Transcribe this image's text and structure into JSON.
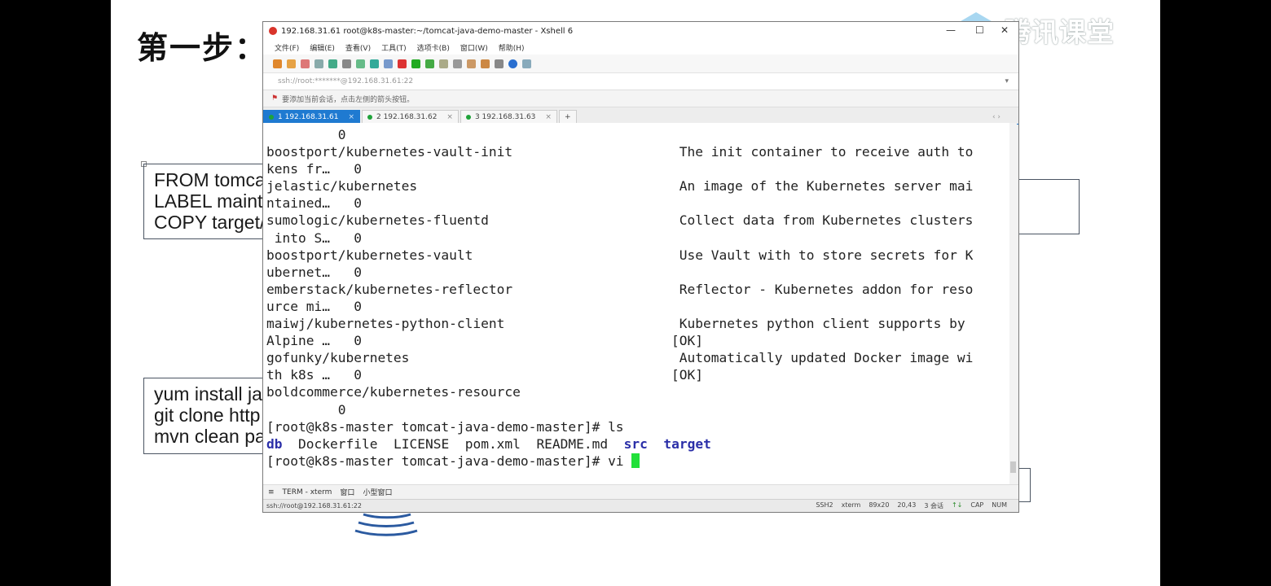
{
  "slide": {
    "title": "第一步：",
    "box1_lines": [
      "FROM tomca",
      "LABEL mainta",
      "COPY target/"
    ],
    "box2_lines": [
      "yum install ja",
      "git clone http",
      "mvn clean pa"
    ]
  },
  "watermark": {
    "text": "腾讯课堂",
    "icon": "play-triangle-icon"
  },
  "window": {
    "title": "192.168.31.61   root@k8s-master:~/tomcat-java-demo-master - Xshell 6",
    "menu": [
      "文件(F)",
      "编辑(E)",
      "查看(V)",
      "工具(T)",
      "选项卡(B)",
      "窗口(W)",
      "帮助(H)"
    ],
    "address": "ssh://root:*******@192.168.31.61:22",
    "notice": "要添加当前会话，点击左侧的箭头按钮。",
    "tabs": [
      {
        "label": "1 192.168.31.61",
        "active": true
      },
      {
        "label": "2 192.168.31.62",
        "active": false
      },
      {
        "label": "3 192.168.31.63",
        "active": false
      }
    ],
    "new_tab": "+",
    "terminal": {
      "rows": [
        {
          "left": "         0",
          "right": ""
        },
        {
          "left": "boostport/kubernetes-vault-init",
          "right": "The init container to receive auth to"
        },
        {
          "left": "kens fr…   0",
          "right": ""
        },
        {
          "left": "jelastic/kubernetes",
          "right": "An image of the Kubernetes server mai"
        },
        {
          "left": "ntained…   0",
          "right": ""
        },
        {
          "left": "sumologic/kubernetes-fluentd",
          "right": "Collect data from Kubernetes clusters"
        },
        {
          "left": " into S…   0",
          "right": ""
        },
        {
          "left": "boostport/kubernetes-vault",
          "right": "Use Vault with to store secrets for K"
        },
        {
          "left": "ubernet…   0",
          "right": ""
        },
        {
          "left": "emberstack/kubernetes-reflector",
          "right": "Reflector - Kubernetes addon for reso"
        },
        {
          "left": "urce mi…   0",
          "right": ""
        },
        {
          "left": "maiwj/kubernetes-python-client",
          "right": "Kubernetes python client supports by"
        },
        {
          "left": "Alpine …   0",
          "right": "[OK]"
        },
        {
          "left": "gofunky/kubernetes",
          "right": "Automatically updated Docker image wi"
        },
        {
          "left": "th k8s …   0",
          "right": "[OK]"
        },
        {
          "left": "boldcommerce/kubernetes-resource",
          "right": ""
        },
        {
          "left": "         0",
          "right": ""
        }
      ],
      "prompt1": "[root@k8s-master tomcat-java-demo-master]# ls",
      "ls_output": [
        {
          "name": "db",
          "dir": true
        },
        {
          "name": "Dockerfile",
          "dir": false
        },
        {
          "name": "LICENSE",
          "dir": false
        },
        {
          "name": "pom.xml",
          "dir": false
        },
        {
          "name": "README.md",
          "dir": false
        },
        {
          "name": "src",
          "dir": true
        },
        {
          "name": "target",
          "dir": true
        }
      ],
      "prompt2": "[root@k8s-master tomcat-java-demo-master]# vi "
    },
    "sendbar": [
      "TERM - xterm",
      "窗口",
      "小型窗口"
    ],
    "status": {
      "left": "ssh://root@192.168.31.61:22",
      "items": [
        "SSH2",
        "xterm",
        "89x20",
        "20,43",
        "3 会话",
        "CAP",
        "NUM"
      ]
    }
  },
  "colors": {
    "dir": "#2b2fa8",
    "cursor": "#22e03a",
    "active_tab": "#1f7ad1"
  }
}
